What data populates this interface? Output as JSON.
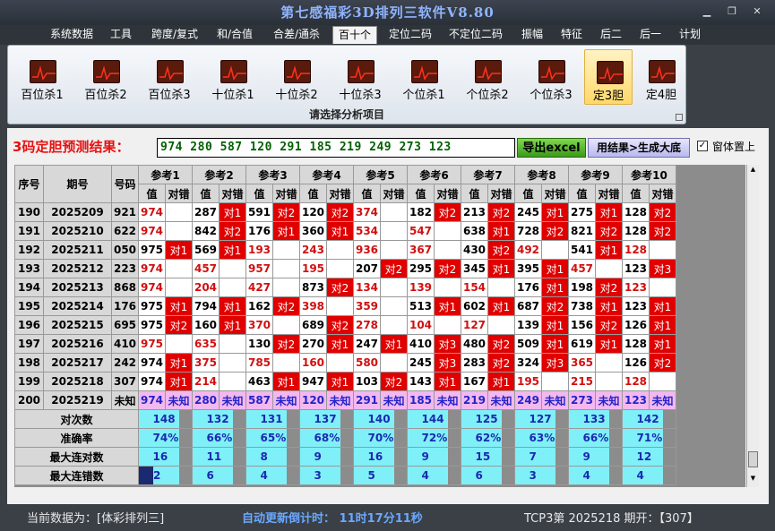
{
  "app": {
    "title": "第七感福彩3D排列三软件V8.80",
    "min": "▁",
    "max": "❐",
    "close": "✕"
  },
  "menu": [
    "系统数据",
    "工具",
    "跨度/复式",
    "和/合值",
    "合差/通杀",
    "百十个",
    "定位二码",
    "不定位二码",
    "振幅",
    "特征",
    "后二",
    "后一",
    "计划"
  ],
  "ribbon": {
    "buttons": [
      "百位杀1",
      "百位杀2",
      "百位杀3",
      "十位杀1",
      "十位杀2",
      "十位杀3",
      "个位杀1",
      "个位杀2",
      "个位杀3",
      "定3胆",
      "定4胆"
    ],
    "active": "定3胆",
    "footer": "请选择分析项目"
  },
  "prediction": {
    "label": "3码定胆预测结果：",
    "value": "974 280 587 120 291 185 219 249 273 123",
    "export_label": "导出excel",
    "generate_label": "用结果>生成大底",
    "topmost_label": "窗体置上",
    "topmost_checked": "✓"
  },
  "table": {
    "col_headers": {
      "seq": "序号",
      "period": "期号",
      "code": "号码",
      "val": "值",
      "mark": "对错"
    },
    "refs": [
      "参考1",
      "参考2",
      "参考3",
      "参考4",
      "参考5",
      "参考6",
      "参考7",
      "参考8",
      "参考9",
      "参考10"
    ],
    "rows": [
      {
        "seq": "190",
        "period": "2025209",
        "code": "921",
        "cells": [
          [
            "974",
            ""
          ],
          [
            "287",
            "对1"
          ],
          [
            "591",
            "对2"
          ],
          [
            "120",
            "对2"
          ],
          [
            "374",
            ""
          ],
          [
            "182",
            "对2"
          ],
          [
            "213",
            "对2"
          ],
          [
            "245",
            "对1"
          ],
          [
            "275",
            "对1"
          ],
          [
            "128",
            "对2"
          ]
        ]
      },
      {
        "seq": "191",
        "period": "2025210",
        "code": "622",
        "cells": [
          [
            "974",
            ""
          ],
          [
            "842",
            "对2"
          ],
          [
            "176",
            "对1"
          ],
          [
            "360",
            "对1"
          ],
          [
            "534",
            ""
          ],
          [
            "547",
            ""
          ],
          [
            "638",
            "对1"
          ],
          [
            "728",
            "对2"
          ],
          [
            "821",
            "对2"
          ],
          [
            "128",
            "对2"
          ]
        ]
      },
      {
        "seq": "192",
        "period": "2025211",
        "code": "050",
        "cells": [
          [
            "975",
            "对1"
          ],
          [
            "569",
            "对1"
          ],
          [
            "193",
            ""
          ],
          [
            "243",
            ""
          ],
          [
            "936",
            ""
          ],
          [
            "367",
            ""
          ],
          [
            "430",
            "对2"
          ],
          [
            "492",
            ""
          ],
          [
            "541",
            "对1"
          ],
          [
            "128",
            ""
          ]
        ]
      },
      {
        "seq": "193",
        "period": "2025212",
        "code": "223",
        "cells": [
          [
            "974",
            ""
          ],
          [
            "457",
            ""
          ],
          [
            "957",
            ""
          ],
          [
            "195",
            ""
          ],
          [
            "207",
            "对2"
          ],
          [
            "295",
            "对2"
          ],
          [
            "345",
            "对1"
          ],
          [
            "395",
            "对1"
          ],
          [
            "457",
            ""
          ],
          [
            "123",
            "对3"
          ]
        ]
      },
      {
        "seq": "194",
        "period": "2025213",
        "code": "868",
        "cells": [
          [
            "974",
            ""
          ],
          [
            "204",
            ""
          ],
          [
            "427",
            ""
          ],
          [
            "873",
            "对2"
          ],
          [
            "134",
            ""
          ],
          [
            "139",
            ""
          ],
          [
            "154",
            ""
          ],
          [
            "176",
            "对1"
          ],
          [
            "198",
            "对2"
          ],
          [
            "123",
            ""
          ]
        ]
      },
      {
        "seq": "195",
        "period": "2025214",
        "code": "176",
        "cells": [
          [
            "975",
            "对1"
          ],
          [
            "794",
            "对1"
          ],
          [
            "162",
            "对2"
          ],
          [
            "398",
            ""
          ],
          [
            "359",
            ""
          ],
          [
            "513",
            "对1"
          ],
          [
            "602",
            "对1"
          ],
          [
            "687",
            "对2"
          ],
          [
            "738",
            "对1"
          ],
          [
            "123",
            "对1"
          ]
        ]
      },
      {
        "seq": "196",
        "period": "2025215",
        "code": "695",
        "cells": [
          [
            "975",
            "对2"
          ],
          [
            "160",
            "对1"
          ],
          [
            "370",
            ""
          ],
          [
            "689",
            "对2"
          ],
          [
            "278",
            ""
          ],
          [
            "104",
            ""
          ],
          [
            "127",
            ""
          ],
          [
            "139",
            "对1"
          ],
          [
            "156",
            "对2"
          ],
          [
            "126",
            "对1"
          ]
        ]
      },
      {
        "seq": "197",
        "period": "2025216",
        "code": "410",
        "cells": [
          [
            "975",
            ""
          ],
          [
            "635",
            ""
          ],
          [
            "130",
            "对2"
          ],
          [
            "270",
            "对1"
          ],
          [
            "247",
            "对1"
          ],
          [
            "410",
            "对3"
          ],
          [
            "480",
            "对2"
          ],
          [
            "509",
            "对1"
          ],
          [
            "619",
            "对1"
          ],
          [
            "128",
            "对1"
          ]
        ]
      },
      {
        "seq": "198",
        "period": "2025217",
        "code": "242",
        "cells": [
          [
            "974",
            "对1"
          ],
          [
            "375",
            ""
          ],
          [
            "785",
            ""
          ],
          [
            "160",
            ""
          ],
          [
            "580",
            ""
          ],
          [
            "245",
            "对3"
          ],
          [
            "283",
            "对2"
          ],
          [
            "324",
            "对3"
          ],
          [
            "365",
            ""
          ],
          [
            "126",
            "对2"
          ]
        ]
      },
      {
        "seq": "199",
        "period": "2025218",
        "code": "307",
        "cells": [
          [
            "974",
            "对1"
          ],
          [
            "214",
            ""
          ],
          [
            "463",
            "对1"
          ],
          [
            "947",
            "对1"
          ],
          [
            "103",
            "对2"
          ],
          [
            "143",
            "对1"
          ],
          [
            "167",
            "对1"
          ],
          [
            "195",
            ""
          ],
          [
            "215",
            ""
          ],
          [
            "128",
            ""
          ]
        ]
      }
    ],
    "predict_row": {
      "seq": "200",
      "period": "2025219",
      "code": "未知",
      "values": [
        "974",
        "280",
        "587",
        "120",
        "291",
        "185",
        "219",
        "249",
        "273",
        "123"
      ],
      "unknown": "未知"
    },
    "stats": [
      {
        "label": "对次数",
        "values": [
          "148",
          "132",
          "131",
          "137",
          "140",
          "144",
          "125",
          "127",
          "133",
          "142"
        ]
      },
      {
        "label": "准确率",
        "values": [
          "74%",
          "66%",
          "65%",
          "68%",
          "70%",
          "72%",
          "62%",
          "63%",
          "66%",
          "71%"
        ]
      },
      {
        "label": "最大连对数",
        "values": [
          "16",
          "11",
          "8",
          "9",
          "16",
          "9",
          "15",
          "7",
          "9",
          "12"
        ]
      },
      {
        "label": "最大连错数",
        "values": [
          "2",
          "6",
          "4",
          "3",
          "5",
          "4",
          "6",
          "3",
          "4",
          "4"
        ]
      }
    ]
  },
  "status": {
    "current": "当前数据为：[体彩排列三]",
    "countdown": "自动更新倒计时：  11时17分11秒",
    "result": "TCP3第 2025218 期开：【307】"
  },
  "colors": {
    "red": "#e00000",
    "pink": "#f3b8ef",
    "cyan": "#7ff0f8",
    "accent": "#8fb4ff"
  }
}
